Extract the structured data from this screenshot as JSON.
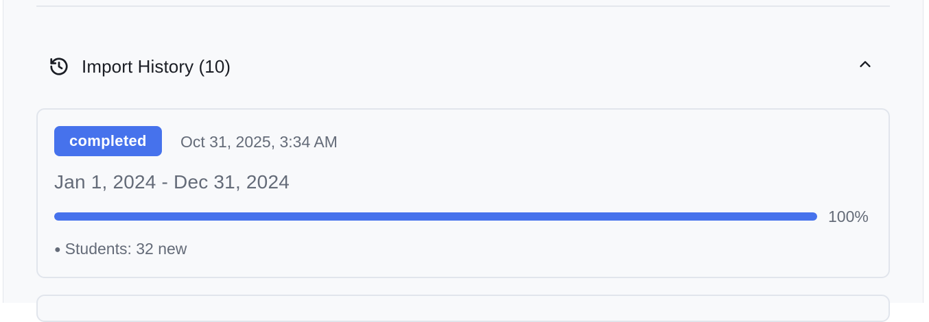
{
  "section": {
    "title": "Import History (10)",
    "icon": "history-icon",
    "collapse_icon": "chevron-up-icon"
  },
  "imports": [
    {
      "status": "completed",
      "timestamp": "Oct 31, 2025, 3:34 AM",
      "date_range": "Jan 1, 2024 - Dec 31, 2024",
      "progress_percent": 100,
      "progress_label": "100%",
      "stats": "Students: 32 new"
    }
  ],
  "colors": {
    "accent": "#4672ec",
    "muted_text": "#646b78",
    "heading_text": "#1a1d24",
    "panel_bg": "#f8f9fb",
    "border": "#e1e5ec"
  }
}
